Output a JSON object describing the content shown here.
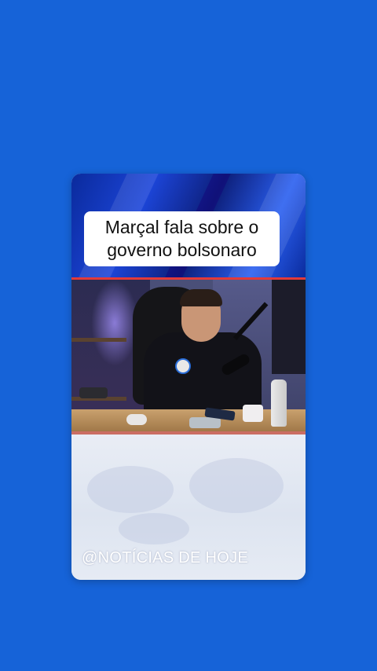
{
  "post": {
    "title_line1": "Marçal fala sobre o",
    "title_line2": "governo bolsonaro",
    "watermark": "@NOTÍCIAS DE HOJE"
  },
  "colors": {
    "background": "#1663d8",
    "title_box": "#ffffff",
    "watermark_text": "#ffffff"
  }
}
